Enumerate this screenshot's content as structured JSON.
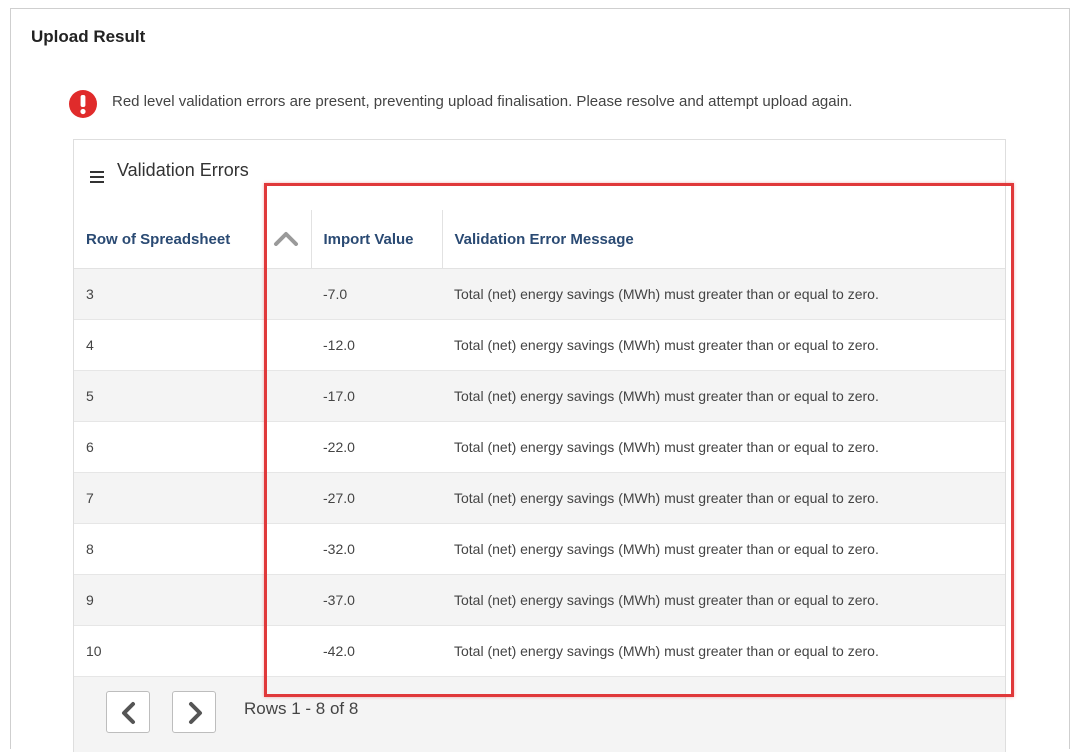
{
  "panel": {
    "title": "Upload Result"
  },
  "alert": {
    "icon": "exclamation-circle-icon",
    "message": "Red level validation errors are present, preventing upload finalisation. Please resolve and attempt upload again."
  },
  "card": {
    "menu_icon": "hamburger-icon",
    "title": "Validation Errors"
  },
  "table": {
    "columns": [
      "Row of Spreadsheet",
      "Import Value",
      "Validation Error Message"
    ],
    "sort_icon": "chevron-up-icon",
    "rows": [
      {
        "row": "3",
        "value": "-7.0",
        "message": "Total (net) energy savings (MWh) must greater than or equal to zero."
      },
      {
        "row": "4",
        "value": "-12.0",
        "message": "Total (net) energy savings (MWh) must greater than or equal to zero."
      },
      {
        "row": "5",
        "value": "-17.0",
        "message": "Total (net) energy savings (MWh) must greater than or equal to zero."
      },
      {
        "row": "6",
        "value": "-22.0",
        "message": "Total (net) energy savings (MWh) must greater than or equal to zero."
      },
      {
        "row": "7",
        "value": "-27.0",
        "message": "Total (net) energy savings (MWh) must greater than or equal to zero."
      },
      {
        "row": "8",
        "value": "-32.0",
        "message": "Total (net) energy savings (MWh) must greater than or equal to zero."
      },
      {
        "row": "9",
        "value": "-37.0",
        "message": "Total (net) energy savings (MWh) must greater than or equal to zero."
      },
      {
        "row": "10",
        "value": "-42.0",
        "message": "Total (net) energy savings (MWh) must greater than or equal to zero."
      }
    ]
  },
  "pager": {
    "prev_icon": "chevron-left-icon",
    "next_icon": "chevron-right-icon",
    "rows_info": "Rows 1 - 8 of 8"
  },
  "colors": {
    "alert_red": "#e02b2b",
    "header_text": "#2a4a73",
    "highlight_border": "#e0383a"
  }
}
